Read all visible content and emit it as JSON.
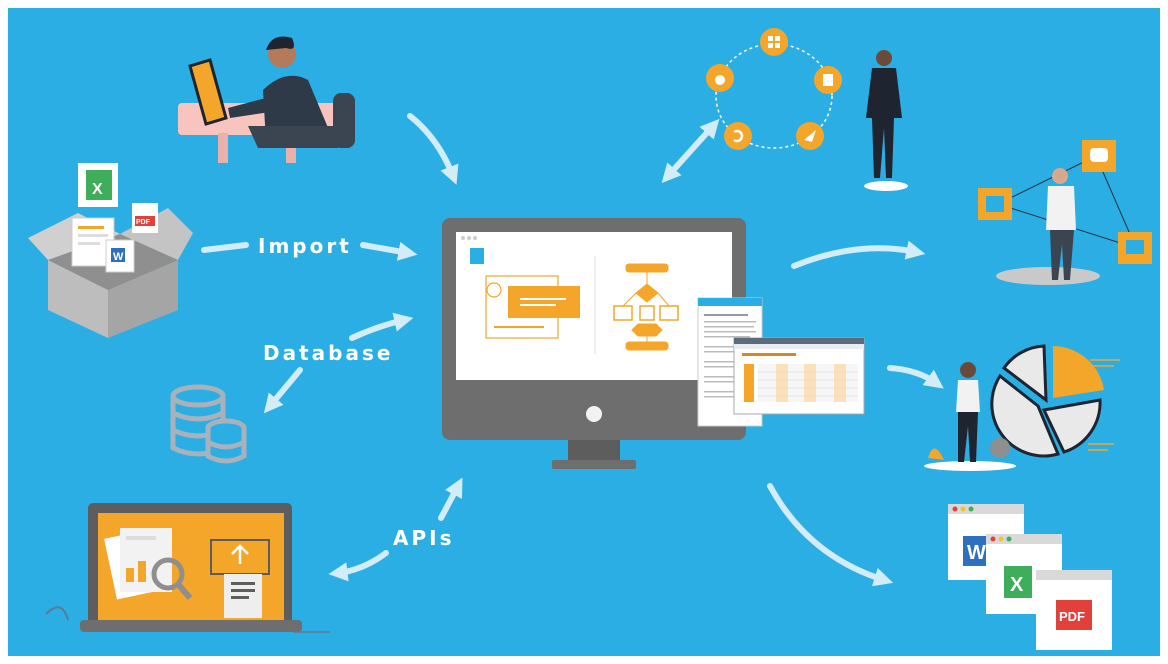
{
  "labels": {
    "import": "Import",
    "database": "Database",
    "apis": "APIs"
  },
  "file_badges": {
    "pdf": "PDF",
    "word": "W",
    "excel": "X"
  },
  "colors": {
    "background": "#2aaee3",
    "accent_orange": "#f4a62a",
    "monitor_gray": "#6e6e6e",
    "white": "#ffffff",
    "excel_green": "#3fae5a",
    "word_blue": "#2f6fc0",
    "pdf_red": "#e2403a"
  },
  "icons": [
    "person-at-laptop-icon",
    "import-box-icon",
    "database-icon",
    "laptop-upload-icon",
    "monitor-icon",
    "app-platform-ring-icon",
    "network-person-icon",
    "pie-chart-person-icon",
    "office-files-icon"
  ]
}
